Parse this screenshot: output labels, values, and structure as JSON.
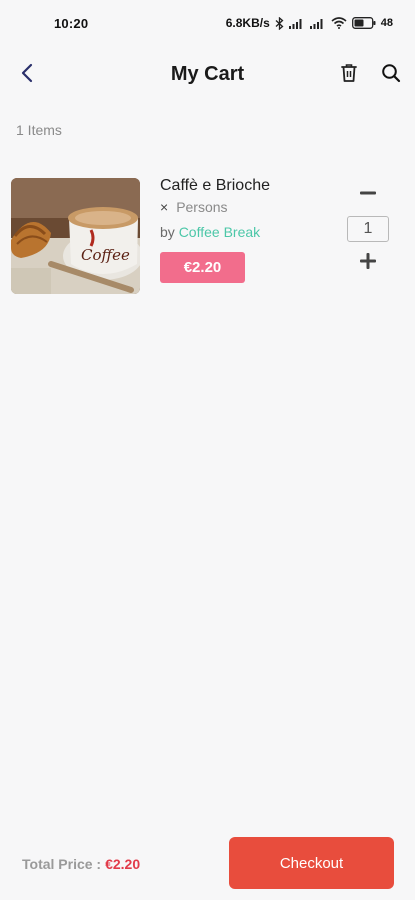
{
  "status_bar": {
    "time": "10:20",
    "network_speed": "6.8KB/s",
    "battery": "48"
  },
  "header": {
    "title": "My Cart",
    "back_icon": "chevron-left-icon",
    "trash_icon": "trash-icon",
    "search_icon": "search-icon"
  },
  "cart": {
    "items_count": "1 Items",
    "items": [
      {
        "name": "Caffè e Brioche",
        "persons_prefix": "×",
        "persons_label": "Persons",
        "vendor_prefix": "by",
        "vendor": "Coffee Break",
        "price": "€2.20",
        "quantity": "1"
      }
    ]
  },
  "footer": {
    "total_label": "Total Price :",
    "total_value": "€2.20",
    "checkout_label": "Checkout"
  },
  "colors": {
    "accent_vendor": "#4cc7a8",
    "price_badge": "#f26d8c",
    "checkout": "#e84d3d",
    "total_value": "#e23b4a"
  }
}
